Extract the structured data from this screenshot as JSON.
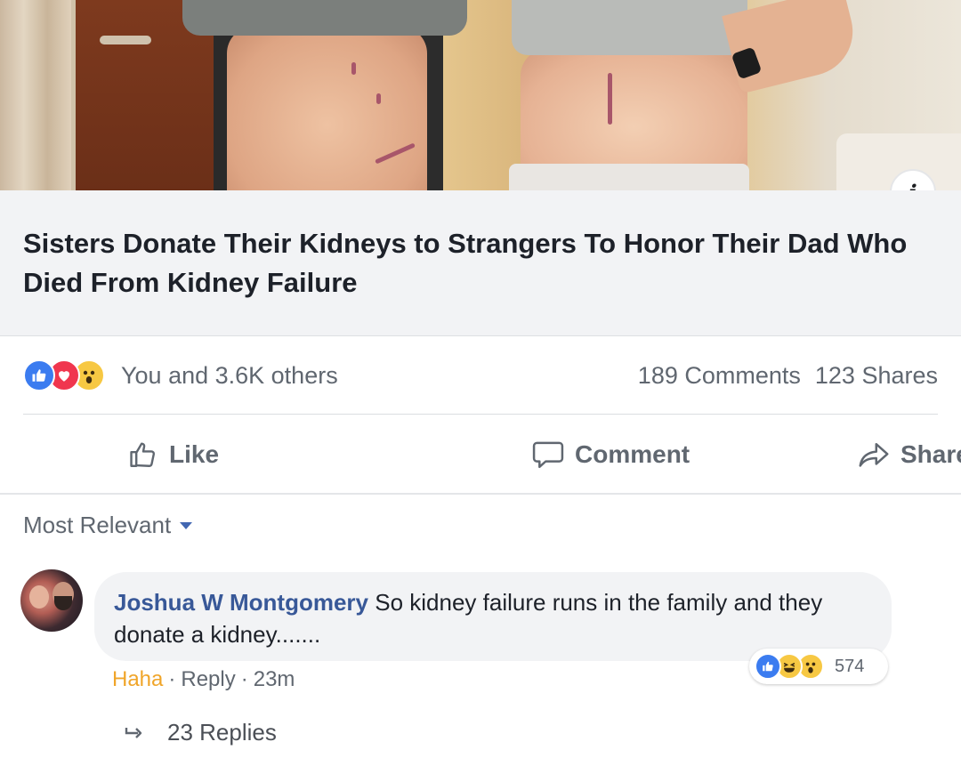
{
  "post": {
    "headline": "Sisters Donate Their Kidneys to Strangers To Honor Their Dad Who Died From Kidney Failure",
    "info_icon": "i",
    "reactions_summary": "You and 3.6K others",
    "comments_count": "189 Comments",
    "shares_count": "123 Shares",
    "reaction_icons": [
      "like-icon",
      "love-icon",
      "wow-icon"
    ]
  },
  "actions": {
    "like": "Like",
    "comment": "Comment",
    "share": "Share"
  },
  "comments": {
    "sort_label": "Most Relevant",
    "items": [
      {
        "author": "Joshua W Montgomery",
        "text": "So kidney failure runs in the family and they donate a kidney.......",
        "reaction_label": "Haha",
        "reply_label": "Reply",
        "time": "23m",
        "reaction_count": "574",
        "replies_label": "23 Replies"
      }
    ]
  },
  "colors": {
    "accent": "#385898",
    "like_blue": "#3b7cf0",
    "love_red": "#f0364e",
    "wow_yellow": "#f7c843",
    "haha_orange": "#f0a529"
  }
}
